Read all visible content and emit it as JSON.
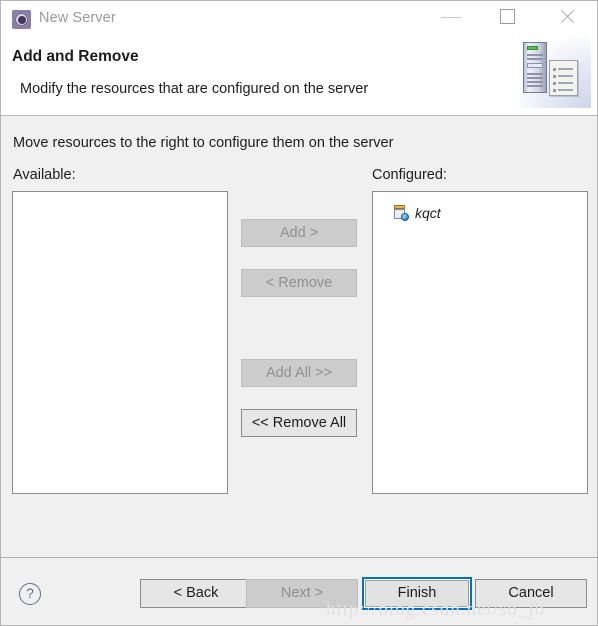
{
  "window": {
    "title": "New Server",
    "icon": "server-gear-icon",
    "controls": {
      "minimize": "minimize-icon",
      "maximize": "maximize-icon",
      "close": "close-icon"
    }
  },
  "header": {
    "title": "Add and Remove",
    "subtitle": "Modify the resources that are configured on the server",
    "banner_icon": "server-tower-document-icon"
  },
  "content": {
    "instruction": "Move resources to the right to configure them on the server",
    "available": {
      "label": "Available:",
      "items": []
    },
    "configured": {
      "label": "Configured:",
      "items": [
        {
          "name": "kqct",
          "icon": "web-module-icon"
        }
      ]
    },
    "transfer_buttons": [
      {
        "label": "Add >",
        "enabled": false
      },
      {
        "label": "< Remove",
        "enabled": false
      },
      {
        "label": "Add All >>",
        "enabled": false
      },
      {
        "label": "<< Remove All",
        "enabled": true
      }
    ]
  },
  "footer": {
    "help": "?",
    "back": "< Back",
    "next": "Next >",
    "finish": "Finish",
    "cancel": "Cancel"
  },
  "watermark": "http://blog.csdn.net/sb_jb",
  "colors": {
    "accent": "#0072c6",
    "dialog_bg": "#f0f0f0",
    "panel_bg": "#ffffff",
    "disabled_text": "#8f8f8f",
    "text": "#1d1d1d",
    "title_text": "#9a9a9a"
  }
}
